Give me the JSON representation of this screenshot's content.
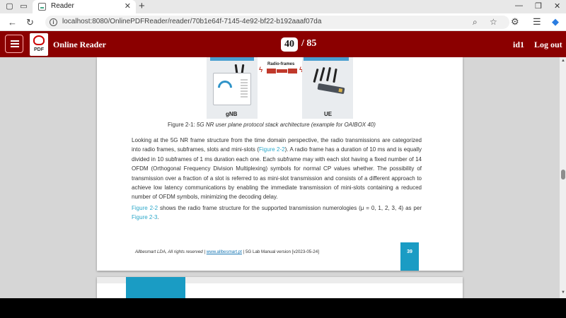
{
  "browser": {
    "tab_title": "Reader",
    "url": "localhost:8080/OnlinePDFReader/reader/70b1e64f-7145-4e92-bf22-b192aaaf07da"
  },
  "app": {
    "name": "Online Reader",
    "logo_text": "PDF",
    "current_page": "40",
    "page_separator": "/",
    "total_pages": "85",
    "user_id": "id1",
    "logout_label": "Log out"
  },
  "page": {
    "figure": {
      "radio_frames_label": "Radio-frames",
      "gnb_label": "gNB",
      "ue_label": "UE",
      "caption_prefix": "Figure 2-1:",
      "caption_text": "5G NR user plane protocol stack architecture (example for OAIBOX 40)"
    },
    "paragraph1": {
      "part1": "Looking at the 5G NR frame structure from the time domain perspective, the radio transmissions are categorized into radio frames, subframes, slots and mini-slots (",
      "link": "Figure 2-2",
      "part2": "). A radio frame has a duration of 10 ms and is equally divided in 10 subframes of 1 ms duration each one. Each subframe may with each slot having a fixed number of 14 OFDM (Orthogonal Frequency Division Multiplexing) symbols for normal CP values whether. The possibility of transmission over a fraction of a slot is referred to as mini-slot transmission and consists of a different approach to achieve low latency communications by enabling the immediate transmission of mini-slots containing a reduced number of OFDM symbols, minimizing the decoding delay."
    },
    "paragraph2": {
      "link1": "Figure 2-2",
      "text1": " shows the radio frame structure for the supported transmission numerologies (μ = 0, 1, 2, 3, 4) as per ",
      "link2": "Figure 2-3",
      "text2": "."
    },
    "footer": {
      "copyright": "Allbesmart LDA, All rights reserved",
      "sep1": " | ",
      "link": "www.allbesmart.pt",
      "sep2": " | ",
      "version": "5G Lab Manual version [v2023-05-24]",
      "page_number": "39"
    }
  },
  "colors": {
    "header_bg": "#8b0000",
    "accent_blue": "#1a9cc4",
    "link": "#2aa7c9"
  }
}
